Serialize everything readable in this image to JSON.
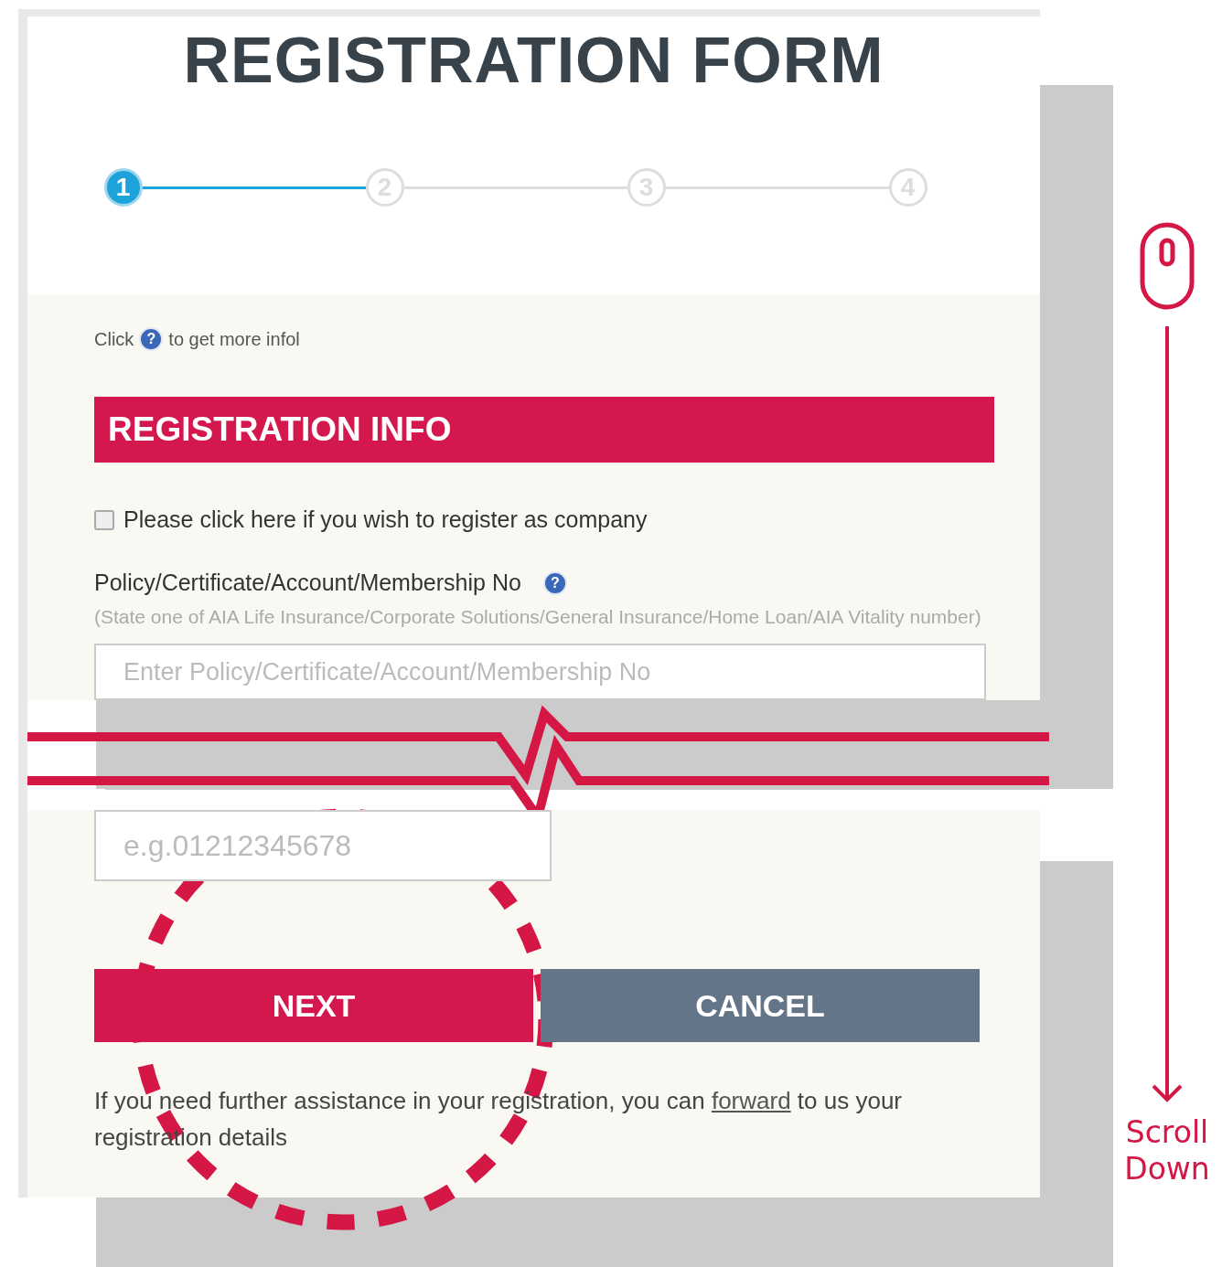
{
  "title": "REGISTRATION FORM",
  "steps": [
    {
      "label": "1",
      "selected": true
    },
    {
      "label": "2",
      "selected": false
    },
    {
      "label": "3",
      "selected": false
    },
    {
      "label": "4",
      "selected": false
    }
  ],
  "hint": {
    "before": "Click",
    "icon": "?",
    "after": "to get more infol"
  },
  "section_title": "REGISTRATION INFO",
  "company_checkbox": {
    "label": "Please click here if you wish to register as company",
    "checked": false
  },
  "policy_field": {
    "label": "Policy/Certificate/Account/Membership No",
    "note": "(State one of AIA Life Insurance/Corporate Solutions/General Insurance/Home Loan/AIA Vitality number)",
    "help_icon": "?",
    "placeholder": "Enter Policy/Certificate/Account/Membership No"
  },
  "phone_field": {
    "placeholder": "e.g.01212345678"
  },
  "buttons": [
    {
      "label": "NEXT",
      "kind": "primary"
    },
    {
      "label": "CANCEL",
      "kind": "secondary"
    }
  ],
  "assistance": {
    "before": "If you need further assistance in your registration, you can",
    "link": "forward",
    "after": "to us your registration details"
  },
  "annotation": {
    "label": "Scroll Down"
  }
}
